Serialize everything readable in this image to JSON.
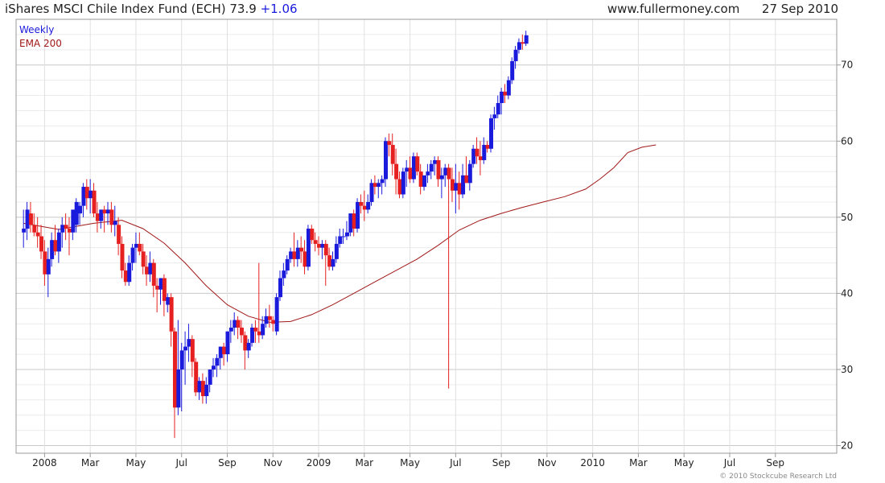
{
  "header": {
    "title": "iShares MSCI Chile Index Fund (ECH)",
    "price": "73.9",
    "change": "+1.06",
    "website": "www.fullermoney.com",
    "date": "27 Sep 2010"
  },
  "footer": {
    "copyright": "© 2010 Stockcube Research Ltd"
  },
  "colors": {
    "up": "#1a1adc",
    "down": "#e62020",
    "ema": "#a01818",
    "grid": "#d4d4d4",
    "axis": "#9a9a9a"
  },
  "chart_data": {
    "type": "candlestick",
    "legend": [
      "Weekly",
      "EMA 200"
    ],
    "legend_position": "top-left",
    "grid": true,
    "ylim": [
      19,
      76
    ],
    "y_ticks": [
      20,
      30,
      40,
      50,
      60,
      70
    ],
    "x_tick_labels": [
      "2008",
      "Mar",
      "May",
      "Jul",
      "Sep",
      "Nov",
      "2009",
      "Mar",
      "May",
      "Jul",
      "Sep",
      "Nov",
      "2010",
      "Mar",
      "May",
      "Jul",
      "Sep"
    ],
    "x_tick_week_index": [
      6,
      19,
      32,
      45,
      58,
      71,
      84,
      97,
      110,
      123,
      136,
      149,
      162,
      175,
      188,
      201,
      214
    ],
    "candles": [
      [
        48,
        51,
        46,
        48.5
      ],
      [
        48.5,
        52,
        47,
        51
      ],
      [
        50.5,
        52,
        48,
        49
      ],
      [
        49,
        50.5,
        47.5,
        48
      ],
      [
        48,
        50,
        46,
        47.5
      ],
      [
        47.5,
        49,
        44.5,
        45.5
      ],
      [
        45.5,
        47,
        41,
        42.5
      ],
      [
        42.5,
        46,
        39.5,
        44.5
      ],
      [
        44.5,
        48,
        43.5,
        47
      ],
      [
        47,
        49,
        45,
        45.5
      ],
      [
        45.5,
        48.5,
        44,
        48
      ],
      [
        48,
        50,
        46,
        49
      ],
      [
        49,
        50.5,
        47,
        48.5
      ],
      [
        48.5,
        50,
        45,
        48
      ],
      [
        48,
        50,
        47,
        51
      ],
      [
        49,
        52.5,
        48,
        52
      ],
      [
        50.5,
        52,
        49,
        51.5
      ],
      [
        51.5,
        54.5,
        50,
        54
      ],
      [
        54,
        55,
        51,
        52.5
      ],
      [
        52.5,
        55,
        50.5,
        53.5
      ],
      [
        53.5,
        54.5,
        50,
        50.5
      ],
      [
        50.5,
        52,
        48,
        49.5
      ],
      [
        49.5,
        51,
        48.5,
        51
      ],
      [
        51,
        51.5,
        48,
        50.5
      ],
      [
        50.5,
        52,
        49,
        51
      ],
      [
        51,
        52,
        48,
        49
      ],
      [
        49,
        51.5,
        47.5,
        49.5
      ],
      [
        49,
        50,
        45,
        46.5
      ],
      [
        46.5,
        47.5,
        42,
        43
      ],
      [
        43,
        44,
        41,
        41.5
      ],
      [
        41.5,
        45,
        41,
        44
      ],
      [
        44,
        46.5,
        43,
        46
      ],
      [
        46,
        48,
        44,
        46.5
      ],
      [
        46.5,
        48,
        45,
        45.5
      ],
      [
        45.5,
        46.5,
        42.5,
        43.5
      ],
      [
        43.5,
        45,
        41,
        42.5
      ],
      [
        42.5,
        45.5,
        41.5,
        44
      ],
      [
        44,
        44.5,
        39.5,
        41
      ],
      [
        41,
        42,
        37.5,
        40.5
      ],
      [
        40.5,
        42,
        38.5,
        42
      ],
      [
        42,
        42.5,
        37,
        39
      ],
      [
        38.5,
        40,
        37.5,
        39.5
      ],
      [
        39.5,
        40,
        33,
        35
      ],
      [
        35,
        35.5,
        21,
        25
      ],
      [
        25,
        36.5,
        24,
        30
      ],
      [
        30,
        33.5,
        24.5,
        32.5
      ],
      [
        32.5,
        35,
        28,
        33
      ],
      [
        33,
        36,
        31,
        34
      ],
      [
        34,
        34.5,
        29,
        31
      ],
      [
        31,
        31.5,
        26.5,
        27
      ],
      [
        27,
        29,
        26,
        28.5
      ],
      [
        28.5,
        29.5,
        25.5,
        26.5
      ],
      [
        26.5,
        29,
        25.5,
        28
      ],
      [
        28,
        30,
        27,
        30
      ],
      [
        30,
        31.5,
        29,
        30.5
      ],
      [
        30.5,
        32,
        29,
        31.5
      ],
      [
        31.5,
        33,
        30,
        33
      ],
      [
        33,
        33.5,
        30.5,
        32
      ],
      [
        32,
        35,
        31,
        35
      ],
      [
        35,
        36.5,
        33.5,
        35.5
      ],
      [
        35.5,
        37.5,
        34.5,
        36.5
      ],
      [
        36.5,
        37,
        34,
        35.5
      ],
      [
        35.5,
        36.5,
        33.5,
        34.5
      ],
      [
        34.5,
        35,
        30,
        32.5
      ],
      [
        32.5,
        34,
        31.5,
        33.5
      ],
      [
        33.5,
        36,
        33,
        35.5
      ],
      [
        35.5,
        36.5,
        33.5,
        35
      ],
      [
        35,
        44,
        33.5,
        34.5
      ],
      [
        34.5,
        37,
        34,
        36
      ],
      [
        36,
        38,
        35.5,
        37
      ],
      [
        37,
        38.5,
        35.5,
        36.5
      ],
      [
        36.5,
        37,
        35,
        36
      ],
      [
        35,
        40,
        34.5,
        39.5
      ],
      [
        39.5,
        43,
        39,
        42
      ],
      [
        42,
        44,
        41,
        43
      ],
      [
        43,
        45,
        42.5,
        44.5
      ],
      [
        44.5,
        46,
        44,
        45.5
      ],
      [
        45.5,
        48,
        43.5,
        44.5
      ],
      [
        44.5,
        47,
        43.5,
        46
      ],
      [
        46,
        47.5,
        44,
        45.5
      ],
      [
        45.5,
        47,
        42.5,
        43.5
      ],
      [
        43.5,
        49,
        43,
        48.5
      ],
      [
        48.5,
        49,
        46.5,
        47
      ],
      [
        47,
        48,
        45.5,
        46.5
      ],
      [
        46.5,
        47.5,
        45,
        46
      ],
      [
        46,
        47,
        44.5,
        46.5
      ],
      [
        46.5,
        47,
        41,
        45
      ],
      [
        45,
        46,
        43,
        43.5
      ],
      [
        43.5,
        45.5,
        43,
        44.5
      ],
      [
        44.5,
        47.5,
        44,
        46.5
      ],
      [
        46.5,
        48.5,
        46,
        47.5
      ],
      [
        47.5,
        48.5,
        46.5,
        47.5
      ],
      [
        47.5,
        49.5,
        47,
        48
      ],
      [
        48,
        50.5,
        47.5,
        50.5
      ],
      [
        50.5,
        51,
        47.5,
        48.5
      ],
      [
        48.5,
        52.5,
        48,
        52
      ],
      [
        52,
        53,
        50.5,
        51.5
      ],
      [
        51.5,
        53.5,
        49.5,
        51
      ],
      [
        51,
        53,
        50.5,
        52
      ],
      [
        52,
        55,
        51.5,
        54.5
      ],
      [
        54.5,
        55.5,
        53,
        54
      ],
      [
        54,
        55,
        52.5,
        54.5
      ],
      [
        54.5,
        55.5,
        53,
        55
      ],
      [
        55,
        60.5,
        54,
        60
      ],
      [
        60,
        61,
        58,
        59.5
      ],
      [
        59.5,
        61,
        55.5,
        57
      ],
      [
        57,
        59,
        53,
        55
      ],
      [
        55,
        56,
        52.5,
        53
      ],
      [
        53,
        56.5,
        52.5,
        56
      ],
      [
        56,
        57.5,
        54,
        56.5
      ],
      [
        56.5,
        58,
        54.5,
        55
      ],
      [
        55,
        58.5,
        54.5,
        58
      ],
      [
        58,
        58.5,
        55.5,
        56
      ],
      [
        56,
        57,
        53,
        54
      ],
      [
        54,
        55,
        53.5,
        55.5
      ],
      [
        55.5,
        57,
        54.5,
        56
      ],
      [
        56,
        57.5,
        55,
        57
      ],
      [
        57,
        58,
        55.5,
        57.5
      ],
      [
        57.5,
        58,
        54,
        55
      ],
      [
        55,
        56.5,
        52.5,
        55.5
      ],
      [
        55.5,
        57,
        54,
        56.5
      ],
      [
        56.5,
        57,
        27.5,
        55
      ],
      [
        55,
        56.5,
        52,
        53.5
      ],
      [
        53.5,
        57,
        50.5,
        54.5
      ],
      [
        54.5,
        56,
        51,
        53
      ],
      [
        53,
        57,
        52.5,
        55.5
      ],
      [
        55.5,
        58,
        54.5,
        54.5
      ],
      [
        54.5,
        57.5,
        53.5,
        57
      ],
      [
        57,
        59.5,
        56.5,
        59
      ],
      [
        59,
        60.5,
        57,
        58
      ],
      [
        58,
        60,
        55.5,
        57.5
      ],
      [
        57.5,
        60.5,
        57,
        59.5
      ],
      [
        59.5,
        60,
        58.5,
        59
      ],
      [
        59,
        63.5,
        58.5,
        63
      ],
      [
        63,
        64.5,
        61.5,
        63.5
      ],
      [
        63.5,
        66,
        63,
        65
      ],
      [
        65,
        67,
        63.5,
        66.5
      ],
      [
        66.5,
        67.5,
        65,
        66
      ],
      [
        66,
        68.5,
        65.5,
        68
      ],
      [
        68,
        71,
        67.5,
        70.5
      ],
      [
        70.5,
        72.5,
        69.5,
        72
      ],
      [
        72,
        73.5,
        71.5,
        73
      ],
      [
        73,
        74,
        72,
        72.8
      ],
      [
        72.8,
        74.5,
        72.5,
        73.9
      ]
    ],
    "ema_200": [
      [
        0,
        49.2
      ],
      [
        10,
        48.4
      ],
      [
        20,
        49.2
      ],
      [
        28,
        49.6
      ],
      [
        34,
        48.5
      ],
      [
        40,
        46.6
      ],
      [
        46,
        44
      ],
      [
        52,
        41
      ],
      [
        58,
        38.5
      ],
      [
        64,
        37
      ],
      [
        70,
        36.2
      ],
      [
        76,
        36.3
      ],
      [
        82,
        37.2
      ],
      [
        88,
        38.5
      ],
      [
        94,
        40
      ],
      [
        100,
        41.5
      ],
      [
        106,
        43
      ],
      [
        112,
        44.5
      ],
      [
        118,
        46.3
      ],
      [
        124,
        48.3
      ],
      [
        130,
        49.6
      ],
      [
        136,
        50.5
      ],
      [
        142,
        51.3
      ],
      [
        148,
        52
      ],
      [
        154,
        52.7
      ],
      [
        160,
        53.7
      ],
      [
        164,
        55
      ],
      [
        168,
        56.5
      ],
      [
        172,
        58.5
      ],
      [
        176,
        59.2
      ],
      [
        180,
        59.5
      ]
    ]
  }
}
